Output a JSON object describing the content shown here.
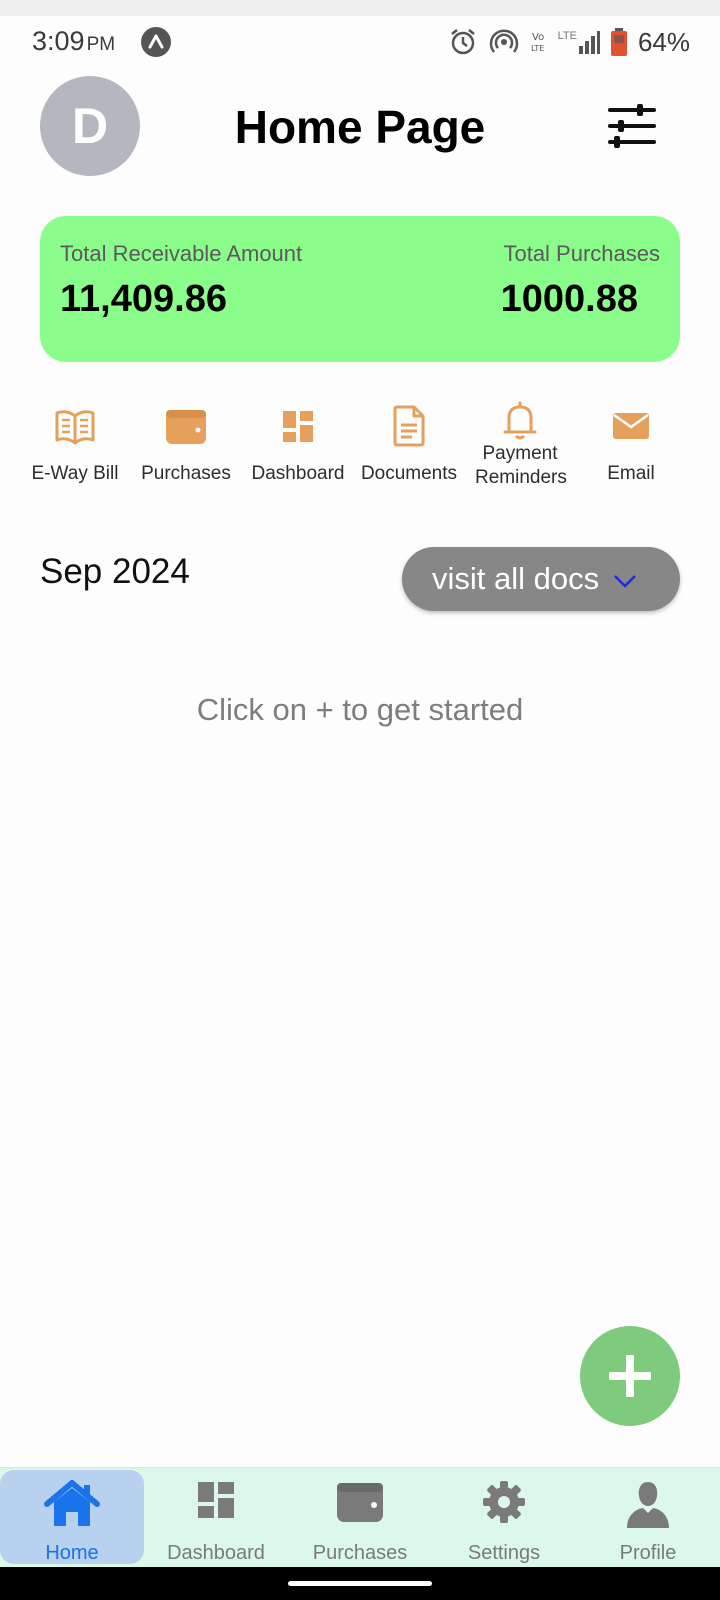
{
  "status_bar": {
    "time": "3:09",
    "ampm": "PM",
    "network": "LTE",
    "battery": "64%"
  },
  "header": {
    "avatar_letter": "D",
    "title": "Home Page"
  },
  "summary": {
    "receivable_label": "Total Receivable Amount",
    "receivable_value": "11,409.86",
    "purchases_label": "Total Purchases",
    "purchases_value": "1000.88"
  },
  "quick_actions": [
    {
      "label": "E-Way Bill",
      "icon": "open-book-icon"
    },
    {
      "label": "Purchases",
      "icon": "wallet-icon"
    },
    {
      "label": "Dashboard",
      "icon": "dashboard-icon"
    },
    {
      "label": "Documents",
      "icon": "document-icon"
    },
    {
      "label": "Payment Reminders",
      "icon": "bell-icon"
    },
    {
      "label": "Email",
      "icon": "envelope-icon"
    }
  ],
  "docs": {
    "month": "Sep 2024",
    "visit_label": "visit all docs",
    "empty_hint": "Click on + to get started"
  },
  "bottom_nav": [
    {
      "label": "Home",
      "icon": "home-icon",
      "active": true
    },
    {
      "label": "Dashboard",
      "icon": "dashboard-icon",
      "active": false
    },
    {
      "label": "Purchases",
      "icon": "wallet-icon",
      "active": false
    },
    {
      "label": "Settings",
      "icon": "gear-icon",
      "active": false
    },
    {
      "label": "Profile",
      "icon": "person-icon",
      "active": false
    }
  ],
  "colors": {
    "summary_bg": "#8bfd8a",
    "quick_icon": "#e5a15c",
    "fab": "#7fcb7e",
    "nav_bg": "#dcf8ea",
    "nav_active_bg": "#b7d1ef",
    "nav_active_text": "#1a73e8"
  }
}
